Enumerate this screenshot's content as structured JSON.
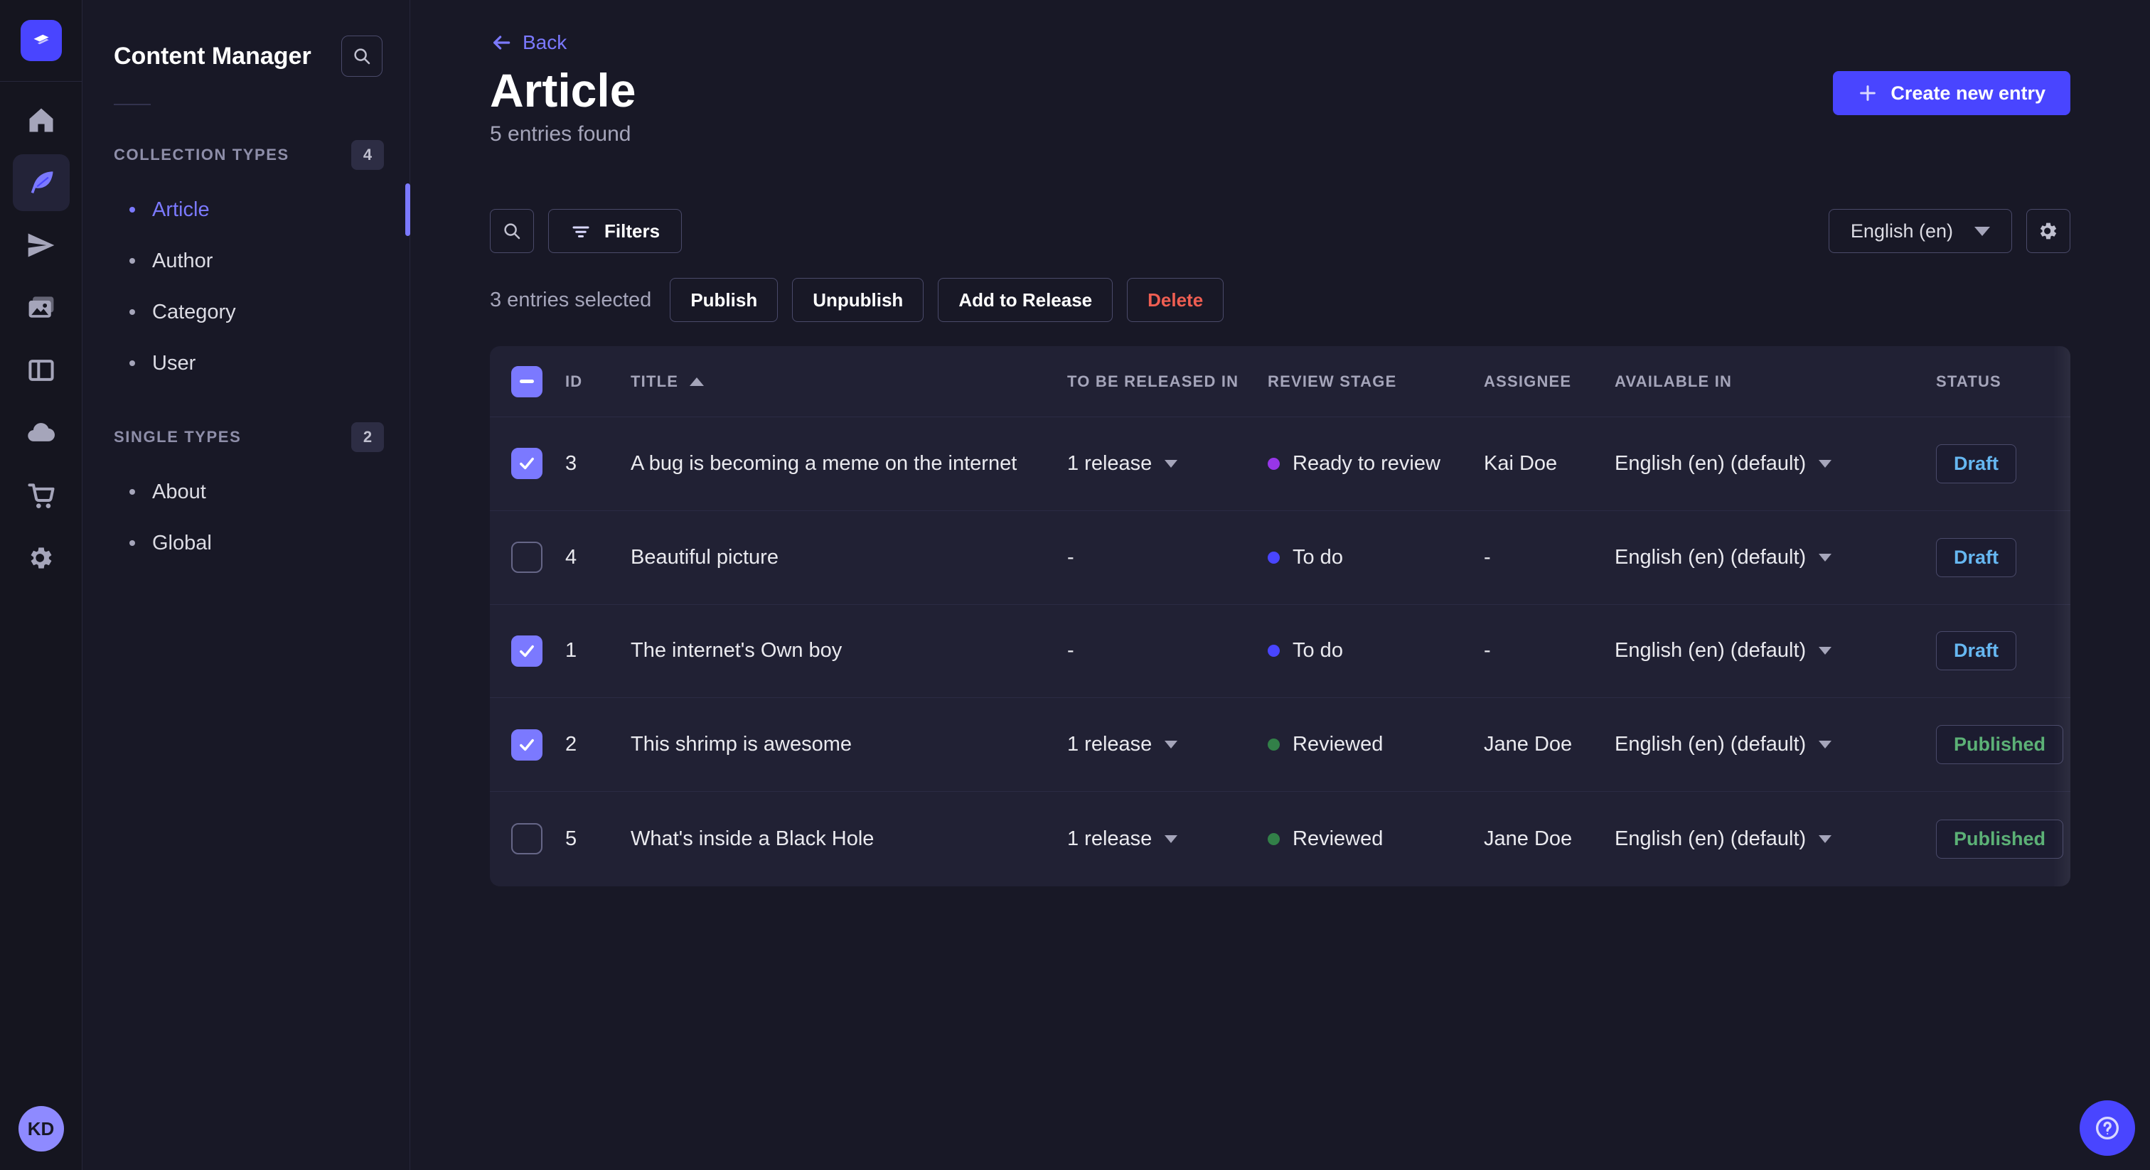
{
  "rail": {
    "icons": [
      "home-icon",
      "feather-icon",
      "paper-plane-icon",
      "media-library-icon",
      "content-builder-icon",
      "cloud-icon",
      "marketplace-cart-icon",
      "settings-gear-icon"
    ],
    "active_icon": "feather-icon",
    "avatar_initials": "KD"
  },
  "sidebar": {
    "title": "Content Manager",
    "sections": [
      {
        "label": "COLLECTION TYPES",
        "badge": "4",
        "items": [
          {
            "label": "Article",
            "active": true
          },
          {
            "label": "Author",
            "active": false
          },
          {
            "label": "Category",
            "active": false
          },
          {
            "label": "User",
            "active": false
          }
        ]
      },
      {
        "label": "SINGLE TYPES",
        "badge": "2",
        "items": [
          {
            "label": "About",
            "active": false
          },
          {
            "label": "Global",
            "active": false
          }
        ]
      }
    ]
  },
  "header": {
    "back_label": "Back",
    "title": "Article",
    "subtitle": "5 entries found",
    "create_label": "Create new entry"
  },
  "toolbar": {
    "filters_label": "Filters",
    "locale_label": "English (en)"
  },
  "selection": {
    "text": "3 entries selected",
    "publish_label": "Publish",
    "unpublish_label": "Unpublish",
    "add_release_label": "Add to Release",
    "delete_label": "Delete"
  },
  "table": {
    "headers": {
      "id": "ID",
      "title": "TITLE",
      "release": "TO BE RELEASED IN",
      "stage": "REVIEW STAGE",
      "assignee": "ASSIGNEE",
      "available": "AVAILABLE IN",
      "status": "STATUS"
    },
    "header_checkbox_state": "indeterminate",
    "sort_column": "TITLE",
    "sort_direction": "ascending",
    "rows": [
      {
        "checked": true,
        "id": "3",
        "title": "A bug is becoming a meme on the internet",
        "release": "1 release",
        "stage": "Ready to review",
        "stage_color": "#9736e8",
        "assignee": "Kai Doe",
        "available": "English (en) (default)",
        "status": "Draft"
      },
      {
        "checked": false,
        "id": "4",
        "title": "Beautiful picture",
        "release": "-",
        "stage": "To do",
        "stage_color": "#4945ff",
        "assignee": "-",
        "available": "English (en) (default)",
        "status": "Draft"
      },
      {
        "checked": true,
        "id": "1",
        "title": "The internet's Own boy",
        "release": "-",
        "stage": "To do",
        "stage_color": "#4945ff",
        "assignee": "-",
        "available": "English (en) (default)",
        "status": "Draft"
      },
      {
        "checked": true,
        "id": "2",
        "title": "This shrimp is awesome",
        "release": "1 release",
        "stage": "Reviewed",
        "stage_color": "#328048",
        "assignee": "Jane Doe",
        "available": "English (en) (default)",
        "status": "Published"
      },
      {
        "checked": false,
        "id": "5",
        "title": "What's inside a Black Hole",
        "release": "1 release",
        "stage": "Reviewed",
        "stage_color": "#328048",
        "assignee": "Jane Doe",
        "available": "English (en) (default)",
        "status": "Published"
      }
    ]
  },
  "colors": {
    "accent": "#4945ff",
    "accent_light": "#7b79ff",
    "draft": "#66b7f1",
    "published": "#5cb176",
    "danger": "#ee5e52"
  }
}
